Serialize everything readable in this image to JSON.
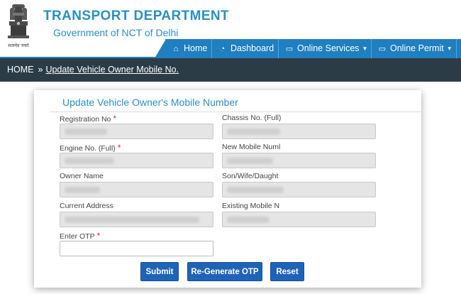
{
  "header": {
    "emblem_caption": "सत्यमेव जयते",
    "title": "TRANSPORT DEPARTMENT",
    "subtitle": "Government of NCT of Delhi"
  },
  "nav": {
    "items": [
      {
        "label": "Home",
        "icon": "home-icon"
      },
      {
        "label": "Dashboard",
        "icon": "dashboard-icon"
      },
      {
        "label": "Online Services",
        "icon": "monitor-icon",
        "dropdown": true
      },
      {
        "label": "Online Permit",
        "icon": "monitor-icon",
        "dropdown": true
      }
    ]
  },
  "breadcrumb": {
    "home": "HOME",
    "separator": "»",
    "current": "Update Vehicle Owner Mobile No."
  },
  "form": {
    "title": "Update Vehicle Owner's Mobile Number",
    "required_mark": "*",
    "fields": {
      "registration_no": {
        "label": "Registration No",
        "required": true
      },
      "chassis_no": {
        "label": "Chassis No. (Full)"
      },
      "engine_no": {
        "label": "Engine No. (Full)",
        "required": true
      },
      "new_mobile": {
        "label": "New Mobile Numl"
      },
      "owner_name": {
        "label": "Owner Name"
      },
      "relation_name": {
        "label": "Son/Wife/Daught"
      },
      "current_address": {
        "label": "Current Address"
      },
      "existing_mobile": {
        "label": "Existing Mobile N"
      },
      "otp": {
        "label": "Enter OTP",
        "required": true,
        "value": ""
      }
    },
    "buttons": {
      "submit": "Submit",
      "regenerate": "Re-Generate OTP",
      "reset": "Reset"
    }
  },
  "colors": {
    "brand_blue": "#2a8fc4",
    "nav_blue": "#1f7fc0",
    "breadcrumb_bg": "#2b3c47",
    "button_blue": "#1e63b8",
    "required_red": "#d9312b"
  }
}
